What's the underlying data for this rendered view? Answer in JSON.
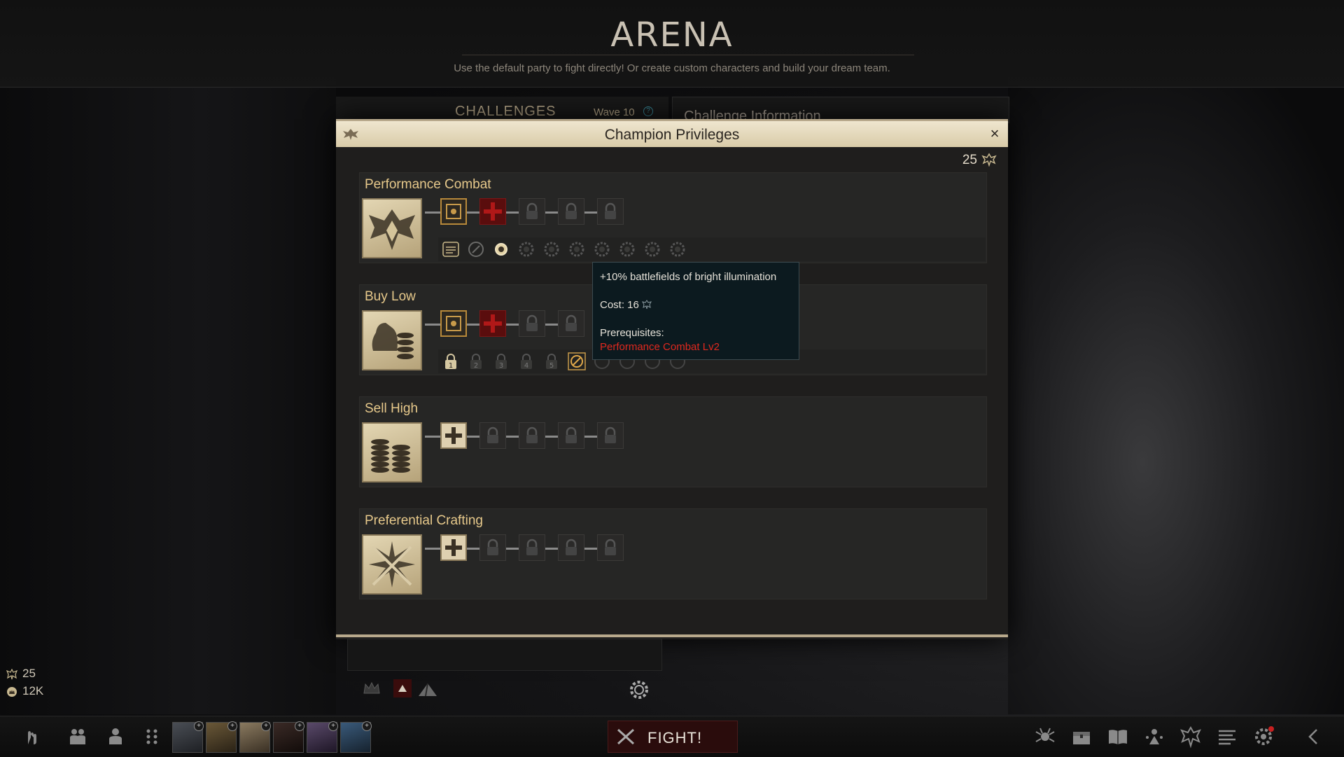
{
  "header": {
    "title": "ARENA",
    "subtitle": "Use the default party to fight directly! Or create custom characters and build your dream team."
  },
  "arena_tabs": {
    "challenges_label": "CHALLENGES",
    "wave_label": "Wave 10",
    "help": "?",
    "info_label": "Challenge Information"
  },
  "dialog": {
    "title": "Champion Privileges",
    "close": "×",
    "points": "25",
    "sections": [
      {
        "name": "Performance Combat",
        "emblem": "winged-shield-icon",
        "nodes": [
          "gold-frame",
          "red-cross",
          "lock",
          "lock",
          "lock"
        ],
        "subnodes": 10
      },
      {
        "name": "Buy Low",
        "emblem": "coin-bag-icon",
        "nodes": [
          "gold-frame",
          "red-cross",
          "lock",
          "lock"
        ],
        "subnodes": 10
      },
      {
        "name": "Sell High",
        "emblem": "coin-stack-icon",
        "nodes": [
          "cream-cross",
          "lock",
          "lock",
          "lock",
          "lock"
        ],
        "subnodes": 0
      },
      {
        "name": "Preferential Crafting",
        "emblem": "crossed-swords-icon",
        "nodes": [
          "cream-cross",
          "lock",
          "lock",
          "lock",
          "lock"
        ],
        "subnodes": 0
      }
    ]
  },
  "tooltip": {
    "effect": "+10% battlefields of bright illumination",
    "cost": "Cost: 16",
    "prereq_label": "Prerequisites:",
    "prereq_value": "Performance Combat Lv2"
  },
  "resources": {
    "champion_points": "25",
    "crowns": "12K"
  },
  "bottom_bar": {
    "fight_label": "FIGHT!",
    "portraits": 6
  },
  "colors": {
    "accent_gold": "#e7c98b",
    "dialog_header": "#e3d6b3",
    "tooltip_red": "#e0281e",
    "fight_bg": "#2a0c0c"
  }
}
